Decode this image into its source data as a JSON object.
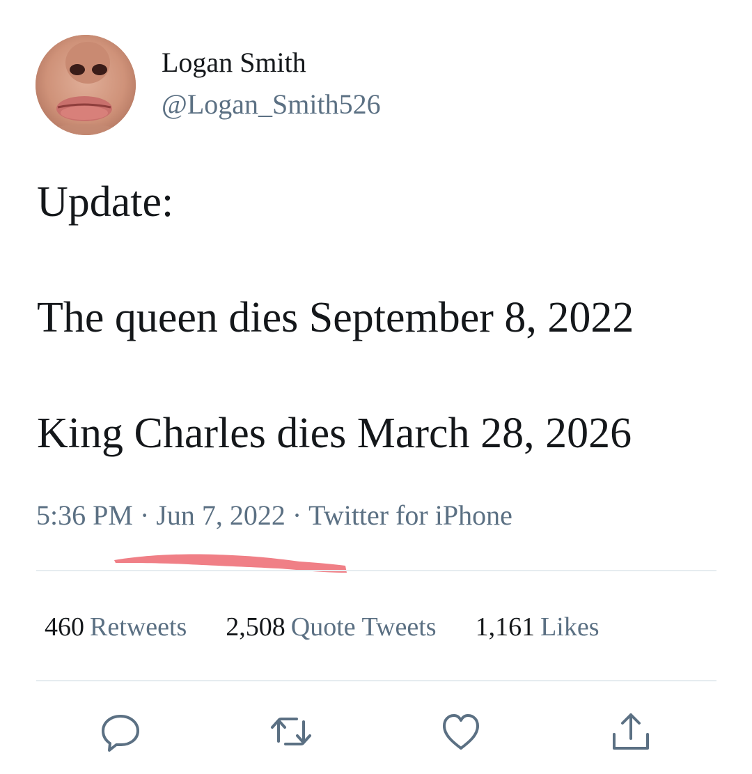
{
  "author": {
    "display_name": "Logan Smith",
    "handle": "@Logan_Smith526"
  },
  "tweet": {
    "lines": [
      "Update:",
      "The queen dies September 8, 2022",
      "King Charles dies March 28, 2026"
    ]
  },
  "meta": {
    "time": "5:36 PM",
    "separator": "·",
    "date": "Jun 7, 2022",
    "source": "Twitter for iPhone",
    "highlight_color": "#f07f86"
  },
  "stats": [
    {
      "count": "460",
      "label": "Retweets"
    },
    {
      "count": "2,508",
      "label": "Quote Tweets"
    },
    {
      "count": "1,161",
      "label": "Likes"
    }
  ],
  "actions": {
    "reply_icon": "reply-icon",
    "retweet_icon": "retweet-icon",
    "like_icon": "heart-icon",
    "share_icon": "share-icon",
    "icon_color": "#5b7083"
  },
  "colors": {
    "primary_text": "#14171a",
    "secondary_text": "#5b7083",
    "divider": "#e6ecf0"
  }
}
